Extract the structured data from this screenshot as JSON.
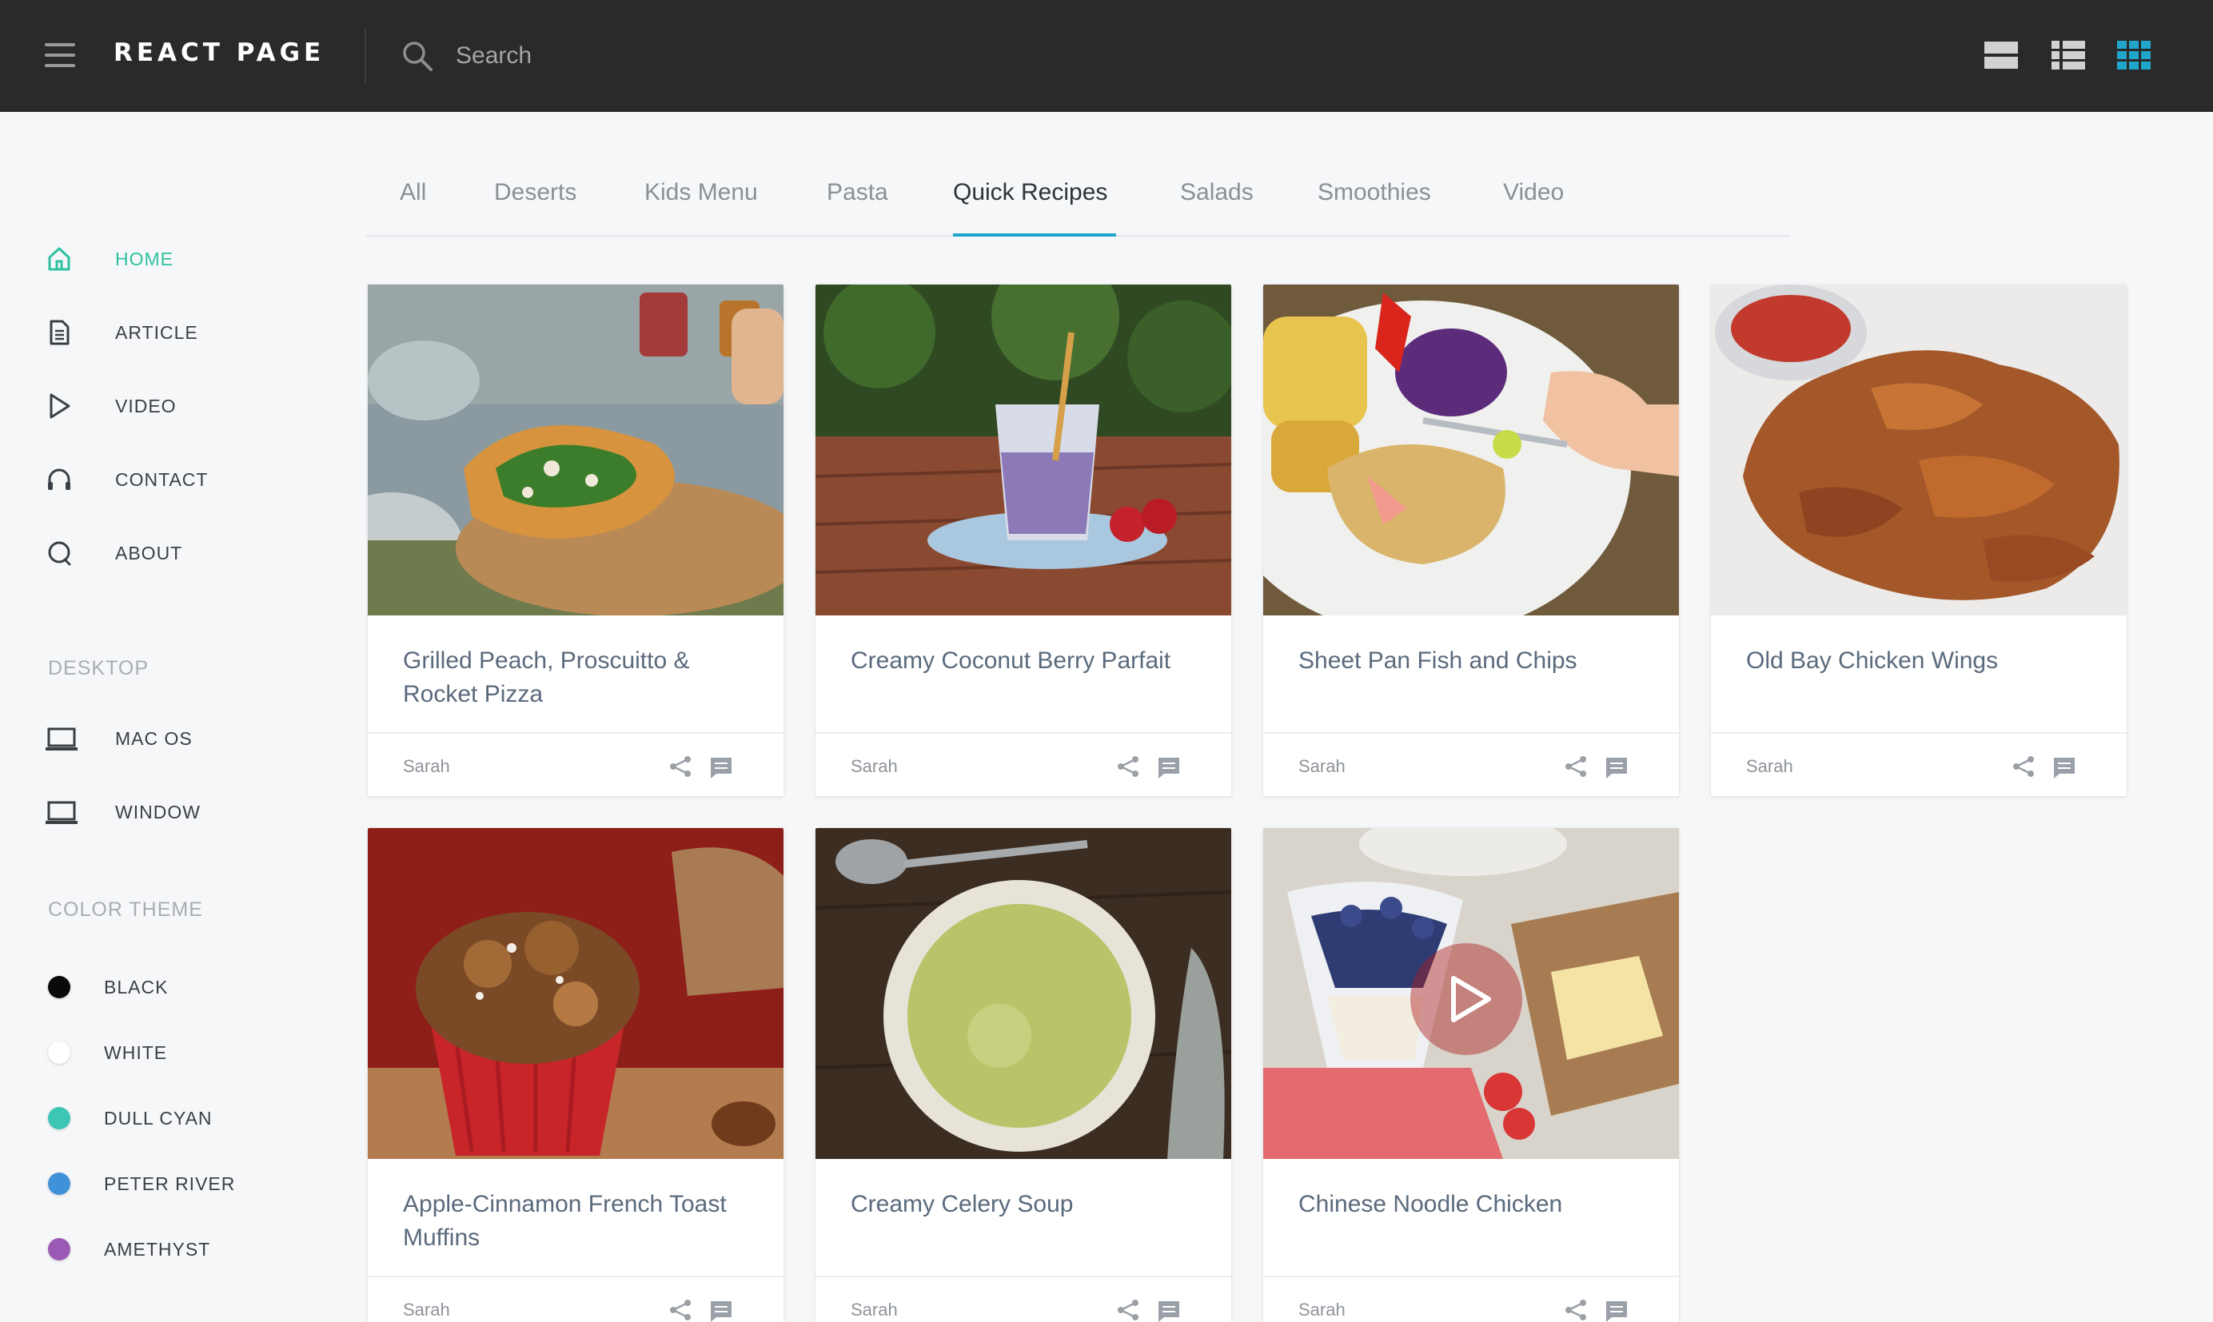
{
  "app": {
    "title": "REACT PAGE"
  },
  "search": {
    "placeholder": "Search"
  },
  "colors": {
    "accent": "#2ec1a0",
    "tab_accent": "#1fa6ca",
    "topbar": "#2b2a2a",
    "grid_view_active": "#1fa6ca"
  },
  "view_toggle": {
    "icons": [
      "card-view-icon",
      "list-view-icon",
      "grid-view-icon"
    ],
    "active": "grid-view-icon"
  },
  "sidebar": {
    "nav": [
      {
        "label": "HOME",
        "icon": "home-icon",
        "active": true
      },
      {
        "label": "ARTICLE",
        "icon": "document-icon",
        "active": false
      },
      {
        "label": "VIDEO",
        "icon": "play-icon",
        "active": false
      },
      {
        "label": "CONTACT",
        "icon": "headphones-icon",
        "active": false
      },
      {
        "label": "ABOUT",
        "icon": "chat-bubble-icon",
        "active": false
      }
    ],
    "desktop_heading": "DESKTOP",
    "desktop": [
      {
        "label": "MAC OS",
        "icon": "laptop-icon"
      },
      {
        "label": "WINDOW",
        "icon": "laptop-icon"
      }
    ],
    "theme_heading": "COLOR THEME",
    "themes": [
      {
        "label": "BLACK",
        "color": "#0a0a0a"
      },
      {
        "label": "WHITE",
        "color": "#ffffff"
      },
      {
        "label": "DULL CYAN",
        "color": "#3cc6b4"
      },
      {
        "label": "PETER RIVER",
        "color": "#3f91d8"
      },
      {
        "label": "AMETHYST",
        "color": "#9b59b6"
      }
    ]
  },
  "tabs": {
    "items": [
      "All",
      "Deserts",
      "Kids Menu",
      "Pasta",
      "Quick Recipes",
      "Salads",
      "Smoothies",
      "Video"
    ],
    "active": "Quick Recipes"
  },
  "cards": [
    {
      "title": "Grilled Peach, Proscuitto & Rocket Pizza",
      "author": "Sarah"
    },
    {
      "title": "Creamy Coconut Berry Parfait",
      "author": "Sarah"
    },
    {
      "title": "Sheet Pan Fish and Chips",
      "author": "Sarah"
    },
    {
      "title": "Old Bay Chicken Wings",
      "author": "Sarah"
    },
    {
      "title": "Apple-Cinnamon French Toast Muffins",
      "author": "Sarah"
    },
    {
      "title": "Creamy Celery Soup",
      "author": "Sarah"
    },
    {
      "title": "Chinese Noodle Chicken",
      "author": "Sarah"
    }
  ]
}
